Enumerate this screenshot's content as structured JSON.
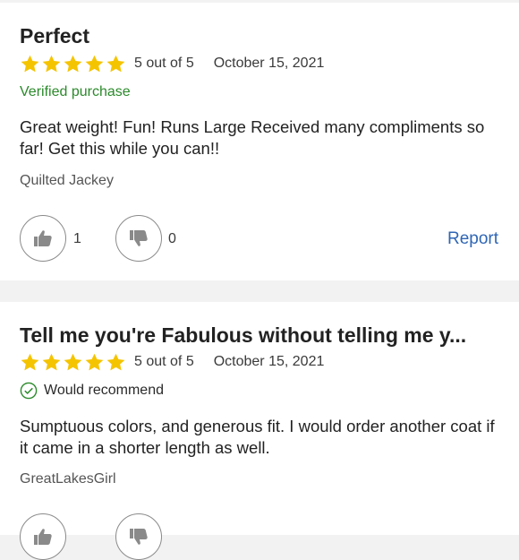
{
  "reviews": [
    {
      "title": "Perfect",
      "stars": 5,
      "rating_text": "5 out of 5",
      "date": "October 15, 2021",
      "badge": "Verified purchase",
      "body": "Great weight! Fun! Runs Large Received many compliments so far! Get this while you can!!",
      "author": "Quilted Jackey",
      "helpful_count": "1",
      "unhelpful_count": "0",
      "report_label": "Report"
    },
    {
      "title": "Tell me you're Fabulous without telling me y...",
      "stars": 5,
      "rating_text": "5 out of 5",
      "date": "October 15, 2021",
      "badge": "Would recommend",
      "body": "Sumptuous colors, and generous fit. I would order another coat if it came in a shorter length as well.",
      "author": "GreatLakesGirl"
    }
  ],
  "colors": {
    "star": "#f5c400",
    "verified": "#2b8a2b",
    "link": "#2f66b5",
    "recommend_check": "#2b8a2b"
  },
  "icons": {
    "star": "star-icon",
    "thumbs_up": "thumbs-up-icon",
    "thumbs_down": "thumbs-down-icon",
    "check_circle": "check-circle-icon"
  }
}
